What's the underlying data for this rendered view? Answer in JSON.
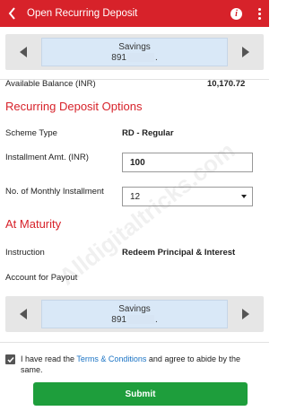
{
  "appbar": {
    "title": "Open Recurring Deposit"
  },
  "source_account": {
    "name": "Savings",
    "number_prefix": "891",
    "number_suffix": "."
  },
  "available_balance": {
    "label": "Available Balance (INR)",
    "value": "10,170.72"
  },
  "rd_options": {
    "heading": "Recurring Deposit Options",
    "scheme_type_label": "Scheme Type",
    "scheme_type_value": "RD - Regular",
    "installment_label": "Installment Amt. (INR)",
    "installment_value": "100",
    "monthly_installment_label": "No. of Monthly Installment",
    "monthly_installment_value": "12"
  },
  "maturity": {
    "heading": "At Maturity",
    "instruction_label": "Instruction",
    "instruction_value": "Redeem Principal & Interest",
    "payout_label": "Account for Payout"
  },
  "payout_account": {
    "name": "Savings",
    "number_prefix": "891",
    "number_suffix": "."
  },
  "terms": {
    "prefix": "I have read the ",
    "link": "Terms & Conditions",
    "suffix": " and agree to abide by the same.",
    "checked": true
  },
  "submit_label": "Submit",
  "watermark": "Alldigitaltricks.com",
  "colors": {
    "brand_red": "#d7222a",
    "submit_green": "#1e9e3c",
    "link_blue": "#1a73c4"
  }
}
